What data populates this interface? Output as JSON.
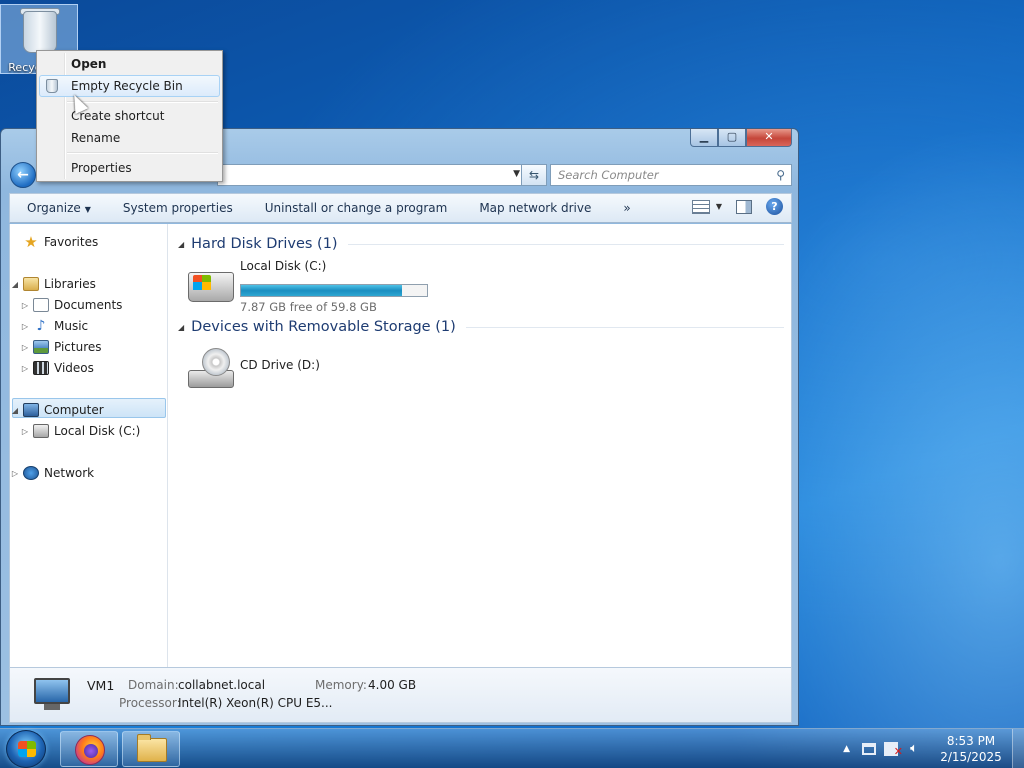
{
  "desktop": {
    "recycle_bin_label": "Recycle Bin"
  },
  "context_menu": {
    "items": [
      {
        "label": "Open"
      },
      {
        "label": "Empty Recycle Bin"
      },
      {
        "label": "Create shortcut"
      },
      {
        "label": "Rename"
      },
      {
        "label": "Properties"
      }
    ]
  },
  "window": {
    "title_buttons": {
      "minimize": "minimize-icon",
      "maximize": "maximize-icon",
      "close": "close-icon"
    },
    "search_placeholder": "Search Computer",
    "toolbar": {
      "organize": "Organize",
      "system_properties": "System properties",
      "uninstall": "Uninstall or change a program",
      "map_drive": "Map network drive",
      "more": "»"
    },
    "nav": {
      "favorites": "Favorites",
      "libraries": "Libraries",
      "documents": "Documents",
      "music": "Music",
      "pictures": "Pictures",
      "videos": "Videos",
      "computer": "Computer",
      "local_disk": "Local Disk (C:)",
      "network": "Network"
    },
    "groups": {
      "hard_disk": "Hard Disk Drives (1)",
      "removable": "Devices with Removable Storage (1)"
    },
    "drives": {
      "c_name": "Local Disk (C:)",
      "c_free": "7.87 GB free of 59.8 GB",
      "c_used_fraction": 0.868,
      "d_name": "CD Drive (D:)"
    },
    "details": {
      "name": "VM1",
      "domain_label": "Domain:",
      "domain_value": "collabnet.local",
      "memory_label": "Memory:",
      "memory_value": "4.00 GB",
      "processor_label": "Processor:",
      "processor_value": "Intel(R) Xeon(R) CPU E5..."
    }
  },
  "taskbar": {
    "time": "8:53 PM",
    "date": "2/15/2025"
  }
}
